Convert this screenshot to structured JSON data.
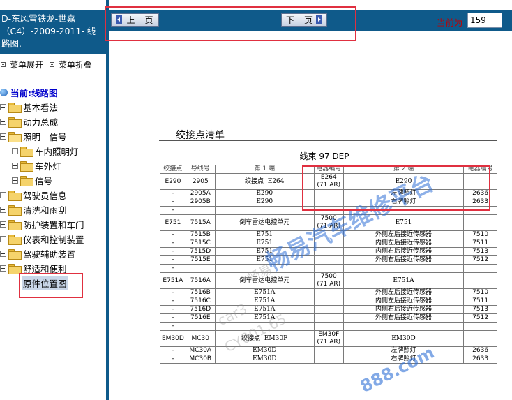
{
  "sidebar": {
    "header_lines": [
      "D-东风雪铁龙-世嘉",
      "（C4）-2009-2011- 线",
      "路图."
    ],
    "expand_label": "菜单展开",
    "collapse_label": "菜单折叠",
    "root_label": "当前:线路图",
    "items": [
      {
        "label": "基本看法",
        "level": 0,
        "expander": "plus"
      },
      {
        "label": "动力总成",
        "level": 0,
        "expander": "plus"
      },
      {
        "label": "照明—信号",
        "level": 0,
        "expander": "minus"
      },
      {
        "label": "车内照明灯",
        "level": 1,
        "expander": "plus"
      },
      {
        "label": "车外灯",
        "level": 1,
        "expander": "plus"
      },
      {
        "label": "信号",
        "level": 1,
        "expander": "plus"
      },
      {
        "label": "驾驶员信息",
        "level": 0,
        "expander": "plus"
      },
      {
        "label": "清洗和雨刮",
        "level": 0,
        "expander": "plus"
      },
      {
        "label": "防护装置和车门",
        "level": 0,
        "expander": "plus"
      },
      {
        "label": "仪表和控制装置",
        "level": 0,
        "expander": "plus"
      },
      {
        "label": "驾驶辅助装置",
        "level": 0,
        "expander": "plus"
      },
      {
        "label": "舒适和便利",
        "level": 0,
        "expander": "plus"
      },
      {
        "label": "原件位置图",
        "level": 0,
        "expander": "none",
        "selected": true
      }
    ]
  },
  "toolbar": {
    "prev_label": "上一页",
    "next_label": "下一页",
    "current_label": "当前为",
    "page_value": "159"
  },
  "document": {
    "title": "绞接点清单",
    "harness": "线束  97 DEP",
    "headers": [
      "绞接点",
      "导线号",
      "第 1 端",
      "电器编号",
      "第 2 端",
      "电器编号"
    ],
    "rows": [
      [
        "E290",
        "2905",
        "绞接点  E264",
        "E264\n(71 AR)",
        "E290",
        ""
      ],
      [
        "-",
        "2905A",
        "E290",
        "",
        "左牌照灯",
        "2636"
      ],
      [
        "-",
        "2905B",
        "E290",
        "",
        "右牌照灯",
        "2633"
      ],
      [
        "-",
        "",
        "",
        "",
        "",
        ""
      ],
      [
        "E751",
        "7515A",
        "倒车雷达电控单元",
        "7500\n(71 AR)",
        "E751",
        ""
      ],
      [
        "-",
        "7515B",
        "E751",
        "",
        "外侧左后接近传感器",
        "7510"
      ],
      [
        "-",
        "7515C",
        "E751",
        "",
        "内侧左后接近传感器",
        "7511"
      ],
      [
        "-",
        "7515D",
        "E751",
        "",
        "内侧右后接近传感器",
        "7513"
      ],
      [
        "-",
        "7515E",
        "E751",
        "",
        "外侧右后接近传感器",
        "7512"
      ],
      [
        "-",
        "",
        "",
        "",
        "",
        ""
      ],
      [
        "E751A",
        "7516A",
        "倒车雷达电控单元",
        "7500\n(71 AR)",
        "E751A",
        ""
      ],
      [
        "-",
        "7516B",
        "E751A",
        "",
        "外侧左后接近传感器",
        "7510"
      ],
      [
        "-",
        "7516C",
        "E751A",
        "",
        "内侧左后接近传感器",
        "7511"
      ],
      [
        "-",
        "7516D",
        "E751A",
        "",
        "内侧右后接近传感器",
        "7513"
      ],
      [
        "-",
        "7516E",
        "E751A",
        "",
        "外侧右后接近传感器",
        "7512"
      ],
      [
        "-",
        "",
        "",
        "",
        "",
        ""
      ],
      [
        "EM30D",
        "MC30",
        "绞接点  EM30F",
        "EM30F\n(71 AR)",
        "EM30D",
        ""
      ],
      [
        "-",
        "MC30A",
        "EM30D",
        "",
        "左牌照灯",
        "2636"
      ],
      [
        "-",
        "MC30B",
        "EM30D",
        "",
        "右牌照灯",
        "2633"
      ]
    ],
    "serif_cols": [
      2,
      4
    ]
  },
  "watermarks": {
    "main": "畅易汽车维修平台",
    "url": "888.com",
    "faint_1": "畅易",
    "faint_2": "car3",
    "faint_3": "CY001.65"
  },
  "colors": {
    "brand_blue": "#0f5a8a",
    "annotation_red": "#e03040",
    "watermark_blue": "#2f6fd6"
  }
}
